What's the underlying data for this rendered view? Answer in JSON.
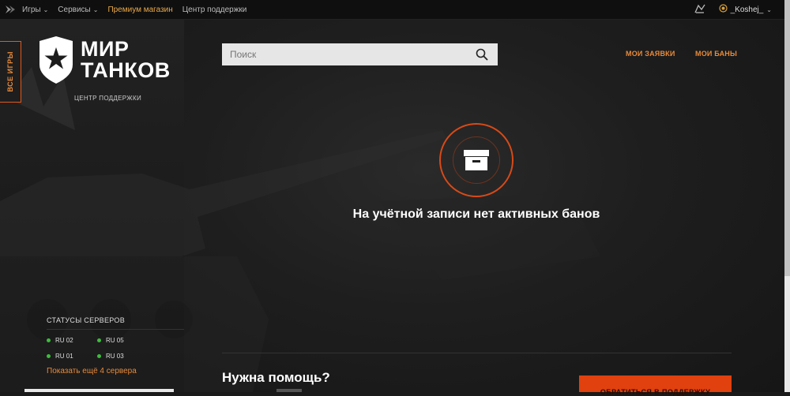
{
  "topbar": {
    "nav": [
      {
        "label": "Игры",
        "has_chevron": true
      },
      {
        "label": "Сервисы",
        "has_chevron": true
      },
      {
        "label": "Премиум магазин",
        "has_chevron": false
      },
      {
        "label": "Центр поддержки",
        "has_chevron": false
      }
    ],
    "username": "_Koshej_"
  },
  "sidebar": {
    "all_games_label": "ВСЕ ИГРЫ",
    "brand_line1": "МИР",
    "brand_line2": "ТАНКОВ",
    "brand_subtitle": "ЦЕНТР ПОДДЕРЖКИ",
    "servers_title": "СТАТУСЫ СЕРВЕРОВ",
    "servers": [
      {
        "name": "RU 02",
        "status_color": "#3cbd3c"
      },
      {
        "name": "RU 05",
        "status_color": "#3cbd3c"
      },
      {
        "name": "RU 01",
        "status_color": "#3cbd3c"
      },
      {
        "name": "RU 03",
        "status_color": "#3cbd3c"
      }
    ],
    "show_more": "Показать ещё 4 сервера"
  },
  "search": {
    "placeholder": "Поиск"
  },
  "header_links": {
    "my_requests": "МОИ ЗАЯВКИ",
    "my_bans": "МОИ БАНЫ"
  },
  "empty_state": {
    "icon": "inbox-icon",
    "text": "На учётной записи нет активных банов"
  },
  "help": {
    "title": "Нужна помощь?",
    "contact_button": "ОБРАТИТЬСЯ В ПОДДЕРЖКУ"
  },
  "colors": {
    "accent": "#e88a3a",
    "button": "#e0410e",
    "ring": "#d84a17",
    "online": "#3cbd3c"
  }
}
